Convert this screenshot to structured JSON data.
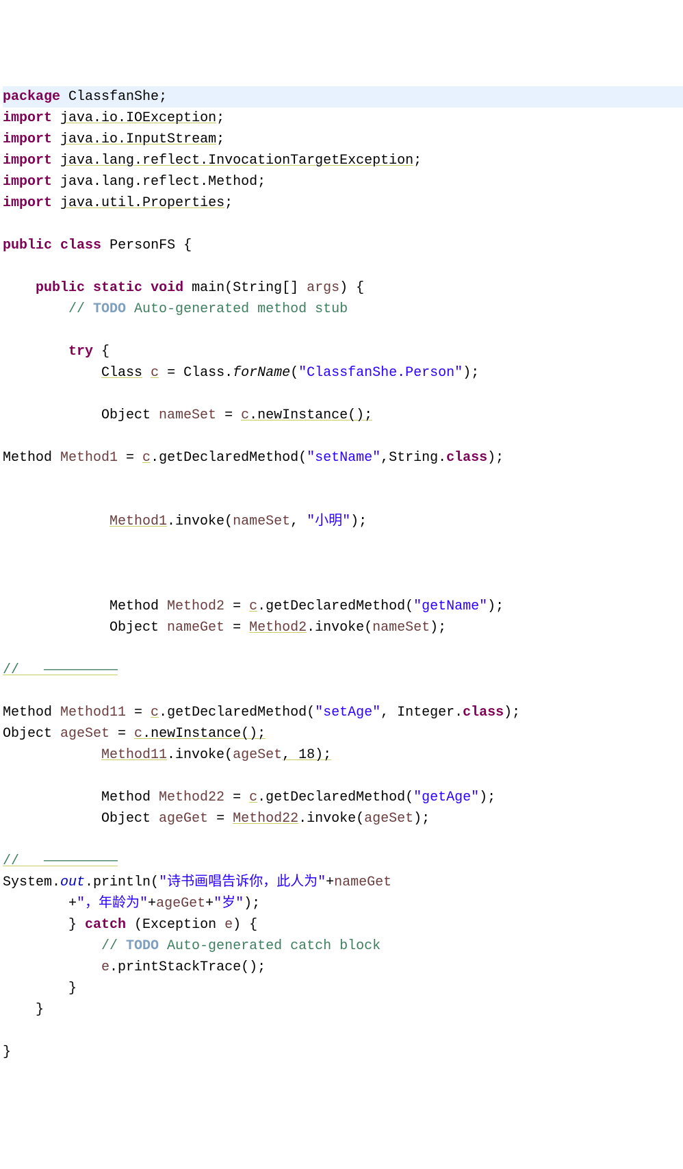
{
  "lines": {
    "l1_pkg": "package",
    "l1_name": "ClassfanShe",
    "l2_imp": "import",
    "l2_name": "java.io.IOException",
    "l3_imp": "import",
    "l3_name": "java.io.InputStream",
    "l4_imp": "import",
    "l4_name": "java.lang.reflect.InvocationTargetException",
    "l5_imp": "import",
    "l5_name": "java.lang.reflect.Method",
    "l6_imp": "import",
    "l6_name": "java.util.Properties",
    "l8_pub": "public",
    "l8_cls": "class",
    "l8_name": "PersonFS {",
    "l10_pub": "public",
    "l10_stat": "static",
    "l10_void": "void",
    "l10_main": "main(String[] ",
    "l10_args": "args",
    "l10_end": ") {",
    "l11a": "// ",
    "l11_todo": "TODO",
    "l11b": " Auto-generated method stub",
    "l13_try": "try",
    "l13b": " {",
    "l14a": "Class",
    "l14_c": "c",
    "l14b": " = Class.",
    "l14_forname": "forName",
    "l14c": "(",
    "l14_str": "\"ClassfanShe.Person\"",
    "l14d": ");",
    "l16a": "Object ",
    "l16_ns": "nameSet",
    "l16b": " = ",
    "l16_c": "c",
    "l16c": ".newInstance();",
    "l18a": "Method ",
    "l18_m1": "Method1",
    "l18b": " = ",
    "l18_c": "c",
    "l18c": ".getDeclaredMethod(",
    "l18_str": "\"setName\"",
    "l18d": ",String.",
    "l18_cls": "class",
    "l18e": ");",
    "l21_m1": "Method1",
    "l21a": ".invoke(",
    "l21_ns": "nameSet",
    "l21b": ", ",
    "l21_str": "\"小明\"",
    "l21c": ");",
    "l24a": "Method ",
    "l24_m2": "Method2",
    "l24b": " = ",
    "l24_c": "c",
    "l24c": ".getDeclaredMethod(",
    "l24_str": "\"getName\"",
    "l24d": ");",
    "l25a": "Object ",
    "l25_ng": "nameGet",
    "l25b": " = ",
    "l25_m2": "Method2",
    "l25c": ".invoke(",
    "l25_ns": "nameSet",
    "l25d": ");",
    "l27": "//   —————————",
    "l29a": "Method ",
    "l29_m11": "Method11",
    "l29b": " = ",
    "l29_c": "c",
    "l29c": ".getDeclaredMethod(",
    "l29_str": "\"setAge\"",
    "l29d": ", Integer.",
    "l29_cls": "class",
    "l29e": ");",
    "l30a": "Object ",
    "l30_as": "ageSet",
    "l30b": " = ",
    "l30_c": "c",
    "l30c": ".newInstance();",
    "l31_m11": "Method11",
    "l31a": ".invoke(",
    "l31_as": "ageSet",
    "l31b": ", 18);",
    "l33a": "Method ",
    "l33_m22": "Method22",
    "l33b": " = ",
    "l33_c": "c",
    "l33c": ".getDeclaredMethod(",
    "l33_str": "\"getAge\"",
    "l33d": ");",
    "l34a": "Object ",
    "l34_ag": "ageGet",
    "l34b": " = ",
    "l34_m22": "Method22",
    "l34c": ".invoke(",
    "l34_as": "ageSet",
    "l34d": ");",
    "l36": "//   —————————",
    "l37a": "System.",
    "l37_out": "out",
    "l37b": ".println(",
    "l37_str1": "\"诗书画唱告诉你，此人为\"",
    "l37c": "+",
    "l37_ng": "nameGet",
    "l38a": "        +",
    "l38_str1": "\"，年龄为\"",
    "l38b": "+",
    "l38_ag": "ageGet",
    "l38c": "+",
    "l38_str2": "\"岁\"",
    "l38d": ");",
    "l39a": "        } ",
    "l39_catch": "catch",
    "l39b": " (Exception ",
    "l39_e": "e",
    "l39c": ") {",
    "l40a": "            // ",
    "l40_todo": "TODO",
    "l40b": " Auto-generated catch block",
    "l41a": "            ",
    "l41_e": "e",
    "l41b": ".printStackTrace();",
    "l42": "        }",
    "l43": "    }",
    "l45": "}"
  }
}
